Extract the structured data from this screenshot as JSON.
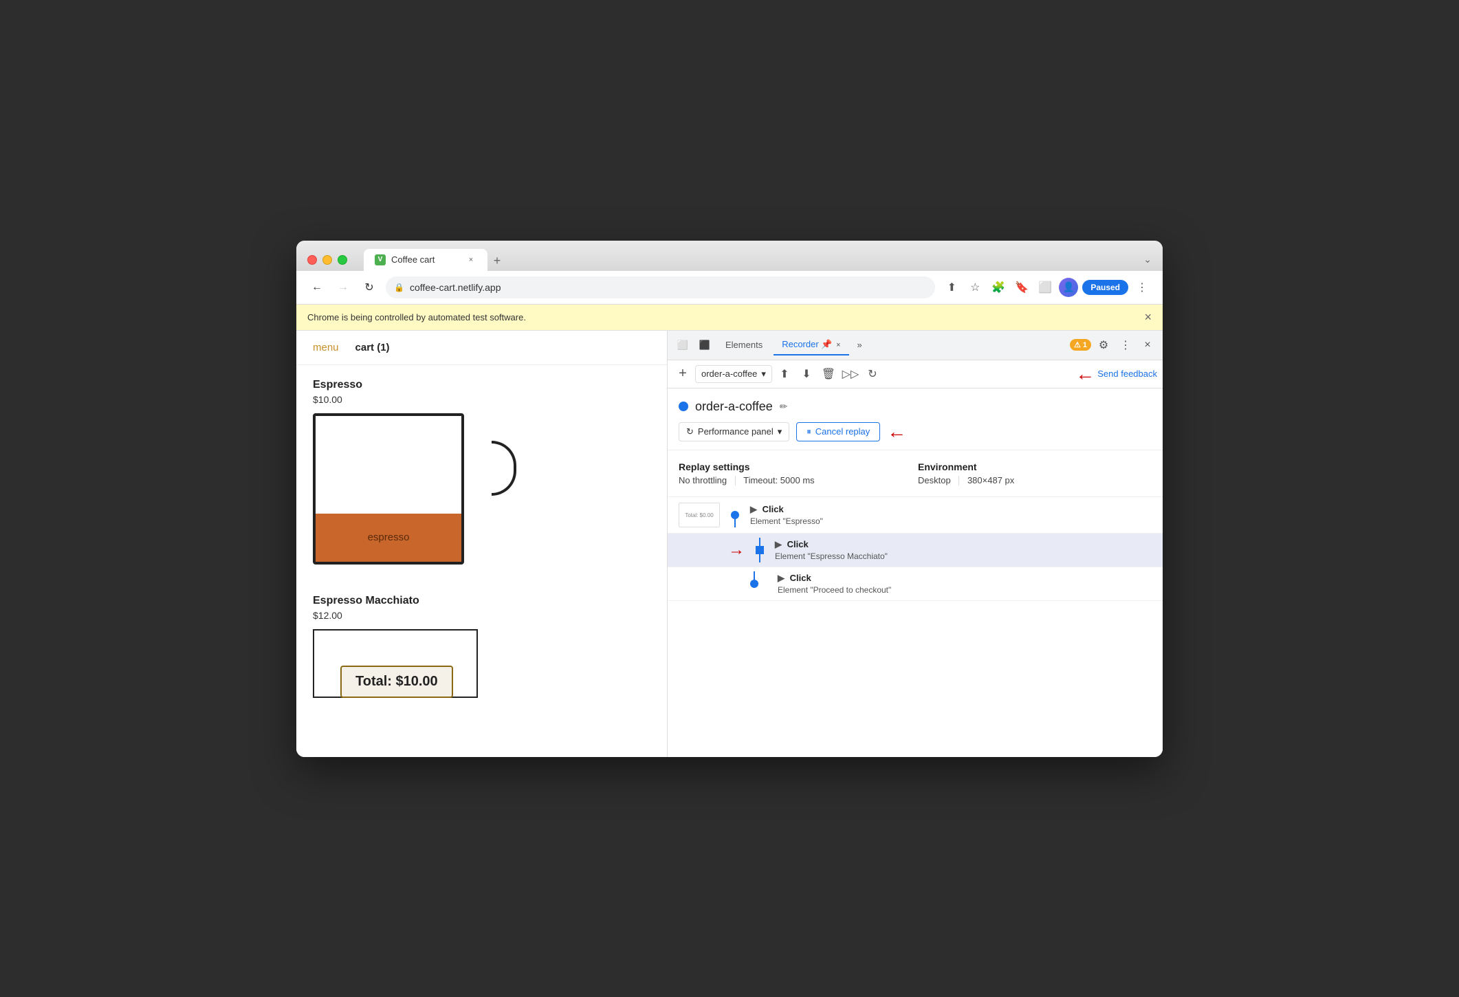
{
  "browser": {
    "tab_favicon": "V",
    "tab_title": "Coffee cart",
    "tab_close": "×",
    "new_tab": "+",
    "chevron": "⌄",
    "nav_back": "←",
    "nav_forward": "→",
    "nav_refresh": "↻",
    "address": "coffee-cart.netlify.app",
    "paused_label": "Paused",
    "automated_msg": "Chrome is being controlled by automated test software.",
    "automated_close": "×"
  },
  "devtools": {
    "toolbar_tabs": [
      "Elements",
      "Recorder 📌",
      "»"
    ],
    "recorder_tab": "Recorder 📌",
    "elements_tab": "Elements",
    "badge_count": "1",
    "add_btn": "+",
    "recording_name": "order-a-coffee",
    "recording_name_placeholder": "order-a-coffee",
    "send_feedback": "Send feedback",
    "recording_dot_color": "#1a73e8",
    "edit_icon": "✏",
    "perf_panel_label": "Performance panel",
    "cancel_replay_label": "⏸ Cancel replay",
    "replay_settings_title": "Replay settings",
    "environment_title": "Environment",
    "no_throttling": "No throttling",
    "timeout": "Timeout: 5000 ms",
    "desktop": "Desktop",
    "resolution": "380×487 px"
  },
  "steps": [
    {
      "id": 1,
      "has_thumbnail": true,
      "thumbnail_text": "Total: $0.00",
      "action": "Click",
      "element": "Element \"Espresso\"",
      "timeline_type": "dot",
      "active": false,
      "has_arrow": false
    },
    {
      "id": 2,
      "has_thumbnail": false,
      "action": "Click",
      "element": "Element \"Espresso Macchiato\"",
      "timeline_type": "square",
      "active": true,
      "has_arrow": true
    },
    {
      "id": 3,
      "has_thumbnail": false,
      "action": "Click",
      "element": "Element \"Proceed to checkout\"",
      "timeline_type": "dot",
      "active": false,
      "has_arrow": false
    }
  ],
  "website": {
    "menu_label": "menu",
    "cart_label": "cart (1)",
    "espresso_name": "Espresso",
    "espresso_price": "$10.00",
    "espresso_liquid_label": "espresso",
    "macchiato_name": "Espresso Macchiato",
    "macchiato_price": "$12.00",
    "total_label": "Total: $10.00"
  },
  "annotations": {
    "arrow1_visible": true,
    "arrow2_visible": true,
    "arrow3_visible": true
  }
}
